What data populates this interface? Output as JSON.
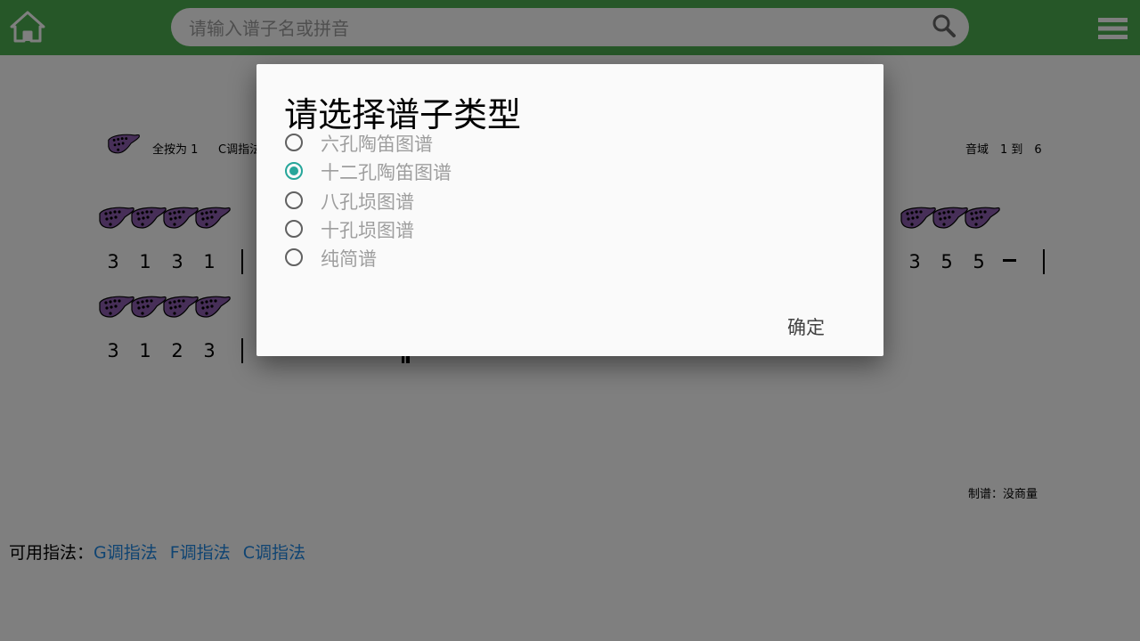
{
  "topbar": {
    "search_placeholder": "请输入谱子名或拼音",
    "bg_color": "#4caf50"
  },
  "score": {
    "header": {
      "all_press": "全按为 1",
      "key_fingering": "C调指法",
      "range": "音域　1 到　6"
    },
    "row1_left_notes": [
      "3",
      "1",
      "3",
      "1"
    ],
    "row1_right_notes": [
      "3",
      "5",
      "5"
    ],
    "row2_notes": [
      "3",
      "1",
      "2",
      "3"
    ],
    "author": "制谱：没商量"
  },
  "fingerings": {
    "label": "可用指法：",
    "options": [
      "G调指法",
      "F调指法",
      "C调指法"
    ],
    "link_color": "#1e88e5"
  },
  "dialog": {
    "title": "请选择谱子类型",
    "options": [
      "六孔陶笛图谱",
      "十二孔陶笛图谱",
      "八孔埙图谱",
      "十孔埙图谱",
      "纯简谱"
    ],
    "selected_index": 1,
    "confirm_label": "确定",
    "accent_color": "#26a69a"
  }
}
